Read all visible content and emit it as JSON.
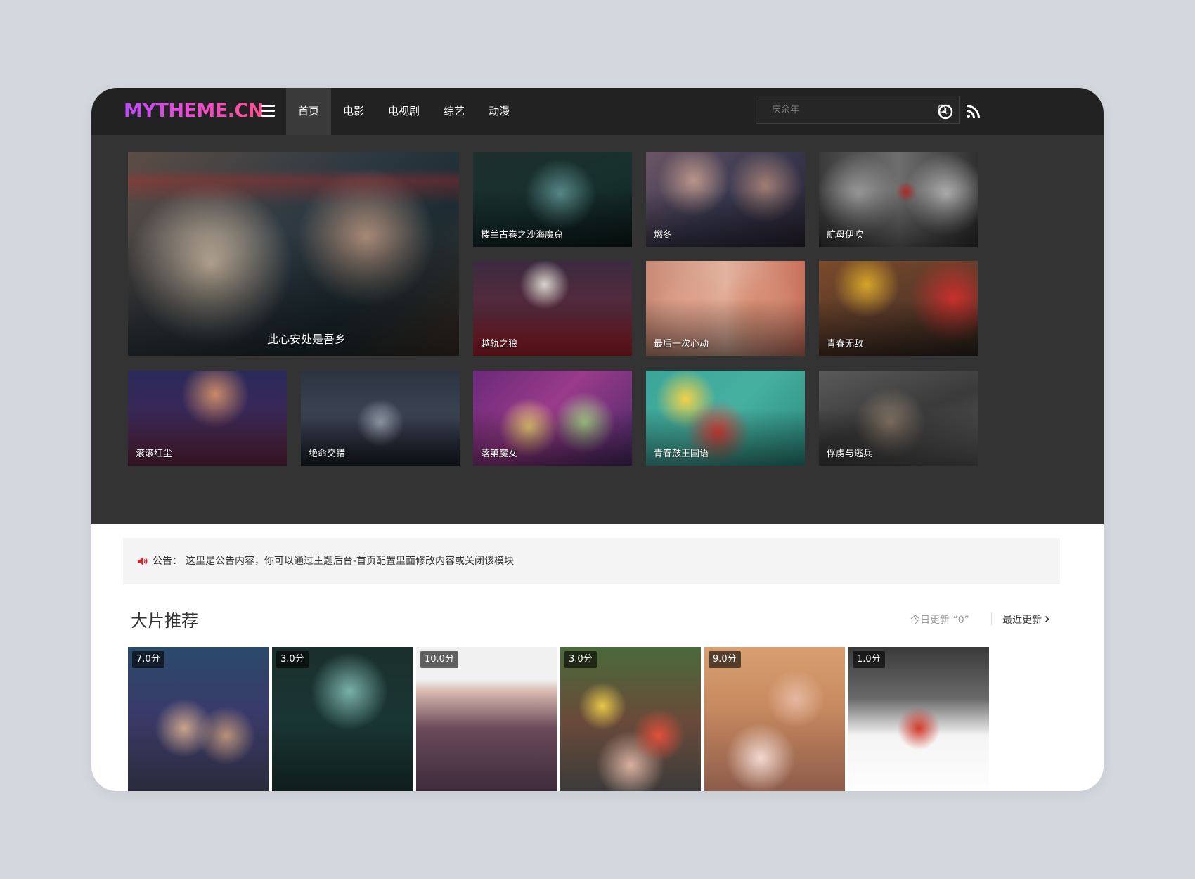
{
  "header": {
    "logo": "MYTHEME.CN",
    "nav": [
      "首页",
      "电影",
      "电视剧",
      "综艺",
      "动漫"
    ],
    "active_nav": "首页",
    "search": {
      "placeholder": "庆余年"
    }
  },
  "hero": {
    "featured": {
      "title": "此心安处是吾乡"
    },
    "tiles": [
      {
        "title": "楼兰古卷之沙海魔窟"
      },
      {
        "title": "燃冬"
      },
      {
        "title": "航母伊吹"
      },
      {
        "title": "越轨之狼"
      },
      {
        "title": "最后一次心动"
      },
      {
        "title": "青春无敌"
      },
      {
        "title": "滚滚红尘"
      },
      {
        "title": "绝命交错"
      },
      {
        "title": "落第魔女"
      },
      {
        "title": "青春鼓王国语"
      },
      {
        "title": "俘虏与逃兵"
      }
    ]
  },
  "notice": {
    "label": "公告：",
    "text": "这里是公告内容，你可以通过主题后台-首页配置里面修改内容或关闭该模块"
  },
  "section": {
    "title": "大片推荐",
    "today_update": "今日更新 “0”",
    "more": "最近更新",
    "posters": [
      {
        "score": "7.0分"
      },
      {
        "score": "3.0分"
      },
      {
        "score": "10.0分"
      },
      {
        "score": "3.0分"
      },
      {
        "score": "9.0分"
      },
      {
        "score": "1.0分"
      }
    ]
  },
  "colors": {
    "header_bg": "#222222",
    "hero_bg": "#333333",
    "logo_gradient_start": "#b94cf2",
    "logo_gradient_end": "#ff4f8e",
    "notice_icon": "#e02020"
  },
  "icons": [
    "menu-icon",
    "search-icon",
    "clock-icon",
    "rss-icon",
    "speaker-icon",
    "chevron-right-icon"
  ]
}
